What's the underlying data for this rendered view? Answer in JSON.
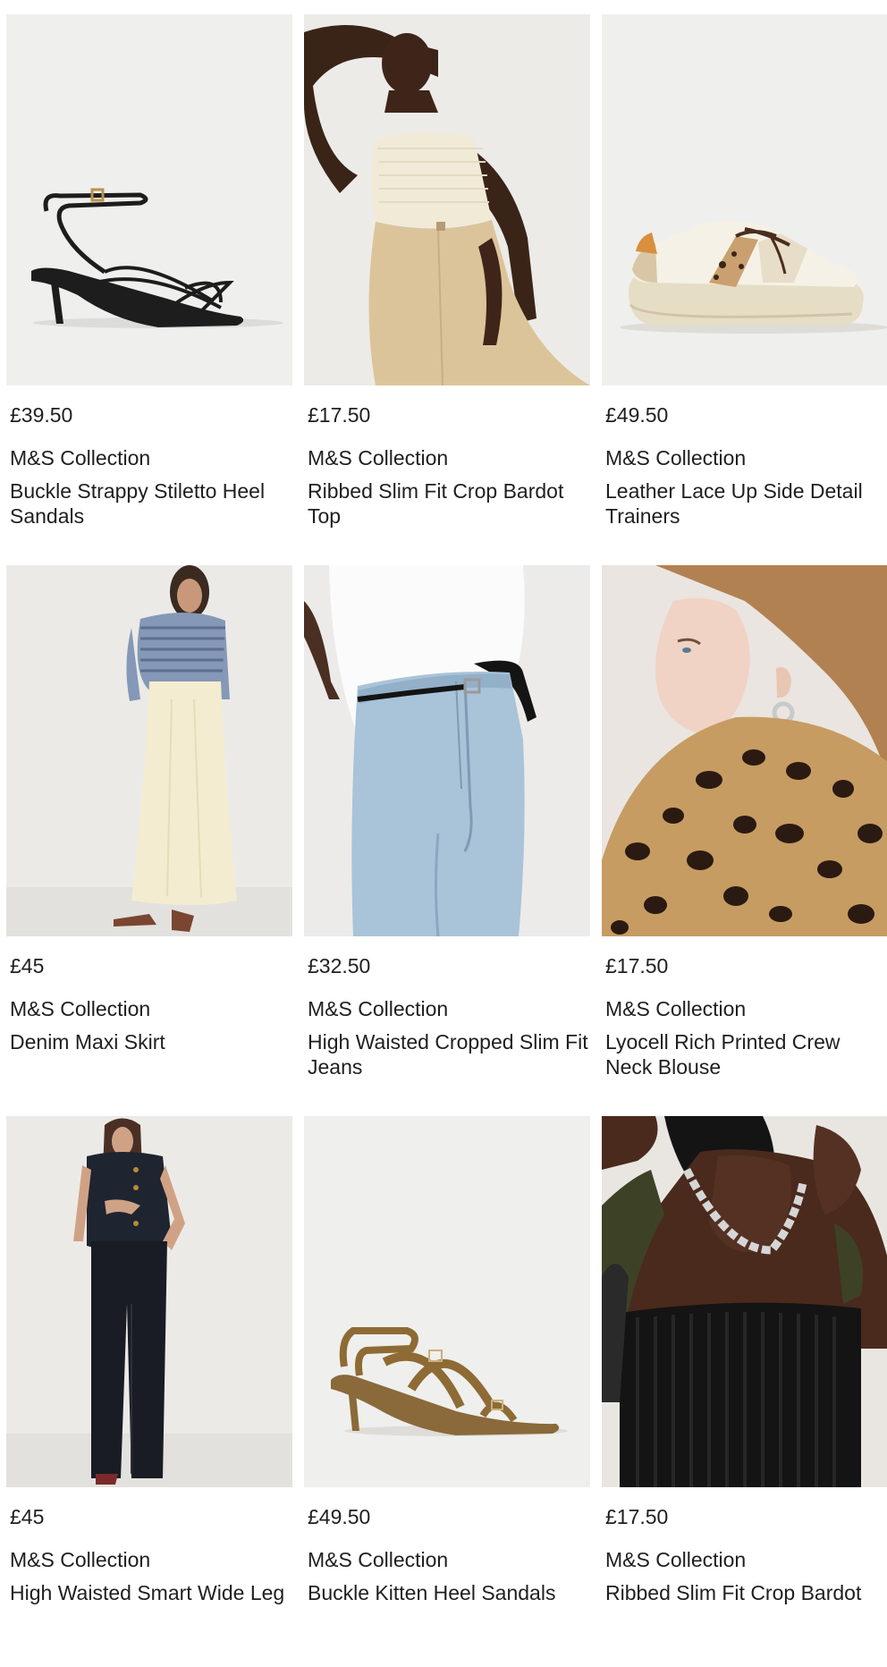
{
  "products": [
    {
      "price": "£39.50",
      "brand": "M&S Collection",
      "title": "Buckle Strappy Stiletto Heel Sandals",
      "image_icon": "black-strappy-sandal"
    },
    {
      "price": "£17.50",
      "brand": "M&S Collection",
      "title": "Ribbed Slim Fit Crop Bardot Top",
      "image_icon": "model-cream-bardot-top"
    },
    {
      "price": "£49.50",
      "brand": "M&S Collection",
      "title": "Leather Lace Up Side Detail Trainers",
      "image_icon": "cream-leopard-trainer"
    },
    {
      "price": "£45",
      "brand": "M&S Collection",
      "title": "Denim Maxi Skirt",
      "image_icon": "model-cream-maxi-skirt"
    },
    {
      "price": "£32.50",
      "brand": "M&S Collection",
      "title": "High Waisted Cropped Slim Fit Jeans",
      "image_icon": "model-light-blue-jeans"
    },
    {
      "price": "£17.50",
      "brand": "M&S Collection",
      "title": "Lyocell Rich Printed Crew Neck Blouse",
      "image_icon": "model-leopard-blouse"
    },
    {
      "price": "£45",
      "brand": "M&S Collection",
      "title": "High Waisted Smart Wide Leg",
      "image_icon": "model-dark-denim-outfit"
    },
    {
      "price": "£49.50",
      "brand": "M&S Collection",
      "title": "Buckle Kitten Heel Sandals",
      "image_icon": "tan-kitten-heel-sandal"
    },
    {
      "price": "£17.50",
      "brand": "M&S Collection",
      "title": "Ribbed Slim Fit Crop Bardot",
      "image_icon": "model-black-bardot-top"
    }
  ],
  "colors": {
    "text": "#1f1f1f",
    "image_background": "#efefed"
  }
}
